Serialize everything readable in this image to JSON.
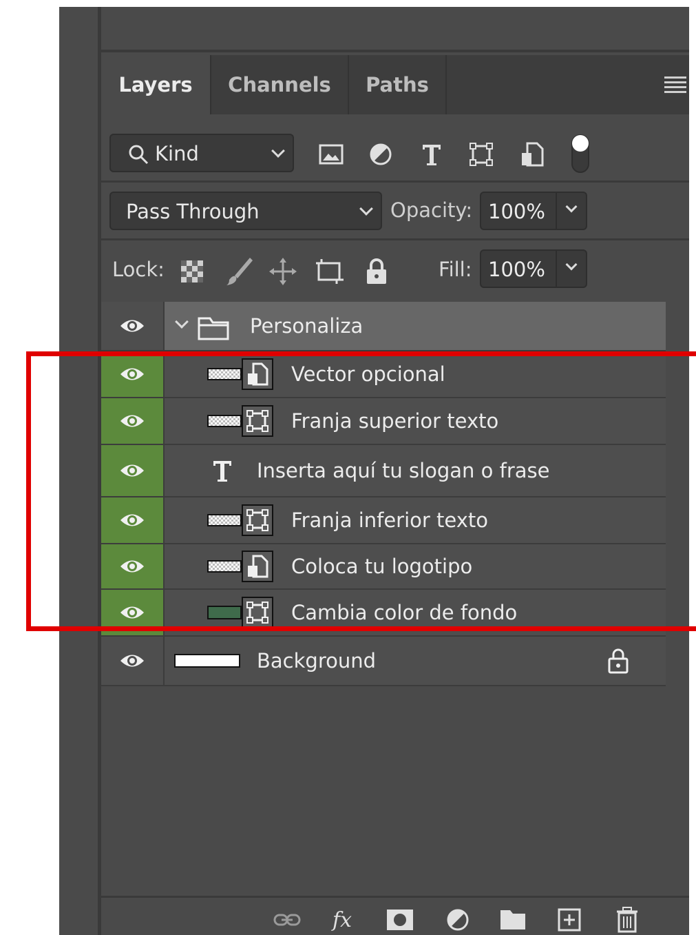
{
  "tabs": [
    {
      "label": "Layers",
      "active": true
    },
    {
      "label": "Channels",
      "active": false
    },
    {
      "label": "Paths",
      "active": false
    }
  ],
  "filter": {
    "kind_label": "Kind",
    "filter_icons": [
      "image-filter-icon",
      "adjustment-filter-icon",
      "type-filter-icon",
      "shape-filter-icon",
      "smart-object-filter-icon",
      "filter-toggle"
    ]
  },
  "blend": {
    "mode": "Pass Through",
    "opacity_label": "Opacity:",
    "opacity_value": "100%"
  },
  "lock": {
    "label": "Lock:",
    "fill_label": "Fill:",
    "fill_value": "100%"
  },
  "layers": [
    {
      "name": "Personaliza",
      "kind": "group",
      "color": ""
    },
    {
      "name": "Vector opcional",
      "kind": "smart",
      "color": "green"
    },
    {
      "name": "Franja superior texto",
      "kind": "shape",
      "color": "green"
    },
    {
      "name": "Inserta aquí tu slogan o frase",
      "kind": "text",
      "color": "green"
    },
    {
      "name": "Franja inferior texto",
      "kind": "shape",
      "color": "green"
    },
    {
      "name": "Coloca tu logotipo",
      "kind": "smart",
      "color": "green"
    },
    {
      "name": "Cambia color de fondo",
      "kind": "shape-filled",
      "color": "green"
    },
    {
      "name": "Background",
      "kind": "background",
      "color": ""
    }
  ],
  "colors": {
    "panel_bg": "#4a4a4a",
    "label_green": "#5c8a3c",
    "highlight_red": "#e00000",
    "group_row": "#676767",
    "fill_swatch": "#3f6b4b"
  },
  "bottom_icons": [
    "link-icon",
    "fx-icon",
    "mask-icon",
    "adjustment-icon",
    "folder-icon",
    "new-layer-icon",
    "trash-icon"
  ]
}
